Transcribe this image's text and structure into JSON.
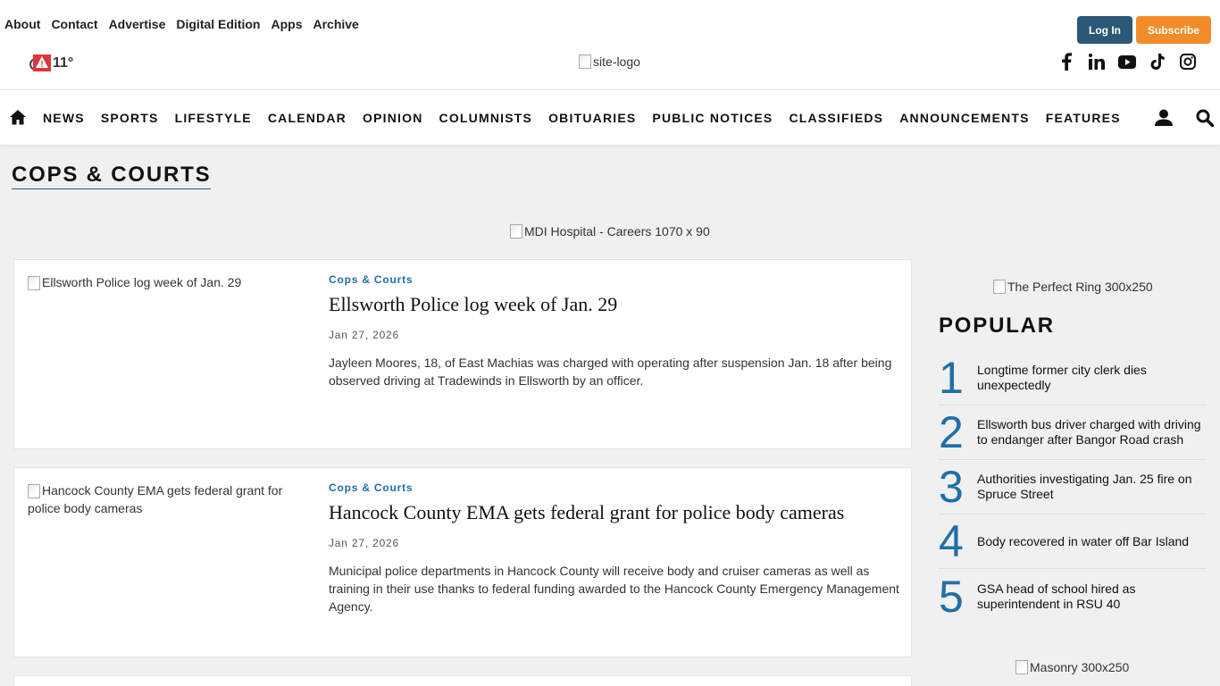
{
  "top_links": [
    "About",
    "Contact",
    "Advertise",
    "Digital Edition",
    "Apps",
    "Archive"
  ],
  "auth": {
    "login_label": "Log In",
    "subscribe_label": "Subscribe"
  },
  "weather": {
    "temp": "11°",
    "icon": "weather-alert-icon"
  },
  "logo_alt": "site-logo",
  "social_icons": [
    "facebook-icon",
    "linkedin-icon",
    "youtube-icon",
    "tiktok-icon",
    "instagram-icon"
  ],
  "nav": {
    "items": [
      "NEWS",
      "SPORTS",
      "LIFESTYLE",
      "CALENDAR",
      "OPINION",
      "COLUMNISTS",
      "OBITUARIES",
      "PUBLIC NOTICES",
      "CLASSIFIEDS",
      "ANNOUNCEMENTS",
      "FEATURES"
    ]
  },
  "page_title": "COPS & COURTS",
  "top_ad_alt": "MDI Hospital - Careers 1070 x 90",
  "articles": [
    {
      "image_alt": "Ellsworth Police log week of Jan. 29",
      "category": "Cops & Courts",
      "headline": "Ellsworth Police log week of Jan. 29",
      "date": "Jan 27, 2026",
      "excerpt": "Jayleen Moores, 18, of East Machias was charged with operating after suspension Jan. 18 after being observed driving at Tradewinds in Ellsworth by an officer."
    },
    {
      "image_alt": "Hancock County EMA gets federal grant for police body cameras",
      "category": "Cops & Courts",
      "headline": "Hancock County EMA gets federal grant for police body cameras",
      "date": "Jan 27, 2026",
      "excerpt": "Municipal police departments in Hancock County will receive body and cruiser cameras as well as training in their use thanks to federal funding awarded to the Hancock County Emergency Management Agency."
    }
  ],
  "sidebar": {
    "ad1_alt": "The Perfect Ring 300x250",
    "popular_title": "POPULAR",
    "popular": [
      {
        "rank": "1",
        "title": "Longtime former city clerk dies unexpectedly"
      },
      {
        "rank": "2",
        "title": "Ellsworth bus driver charged with driving to endanger after Bangor Road crash"
      },
      {
        "rank": "3",
        "title": "Authorities investigating Jan. 25 fire on Spruce Street"
      },
      {
        "rank": "4",
        "title": "Body recovered in water off Bar Island"
      },
      {
        "rank": "5",
        "title": "GSA head of school hired as superintendent in RSU 40"
      }
    ],
    "ad2_alt": "Masonry 300x250"
  }
}
